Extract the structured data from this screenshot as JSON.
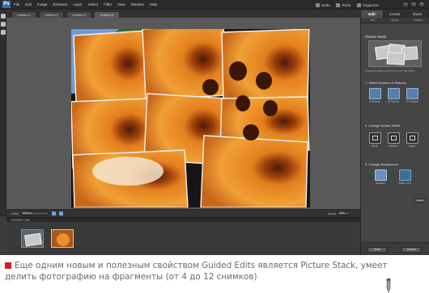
{
  "menu": {
    "logo": "Ps",
    "items": [
      "File",
      "Edit",
      "Image",
      "Enhance",
      "Layer",
      "Select",
      "Filter",
      "View",
      "Window",
      "Help"
    ],
    "actions": [
      "Undo",
      "Redo",
      "Organizer"
    ]
  },
  "doc_tabs": [
    "Untitled-1",
    "Untitled-2",
    "Untitled-3",
    "Untitled-4"
  ],
  "status_bar": {
    "label": "Vivid",
    "field": "Medium",
    "zoom_label": "Zoom",
    "zoom_value": "66%"
  },
  "project_bin": {
    "title": "PROJECT BIN"
  },
  "panel": {
    "tabs": [
      "Edit",
      "Create",
      "Share"
    ],
    "subtabs": [
      "Full",
      "Quick",
      "Guided"
    ],
    "title": "Picture Stack",
    "help": "Drag the sliders and try to see the effect",
    "section1": "1. Select Number of Pictures",
    "section1_opts": [
      "4 Pictures",
      "8 Pictures",
      "12 Pictures"
    ],
    "section2": "2. Change Border Width",
    "section2_opts": [
      "Small",
      "Medium",
      "Large"
    ],
    "section3": "3. Change Background",
    "section3_opts": [
      "Gradient",
      "Solid Color"
    ],
    "reset": "Reset",
    "done": "Done",
    "cancel": "Cancel"
  },
  "caption": {
    "line1": "Еще одним новым и полезным свойством Guided Edits является Picture Stack, умеет",
    "line2": "делить фотографию на фрагменты (от 4 до 12 снимков)"
  },
  "colors": {
    "accent": "#d0202e",
    "petal": "#e8912c",
    "ui_dark": "#3c3c3c"
  }
}
